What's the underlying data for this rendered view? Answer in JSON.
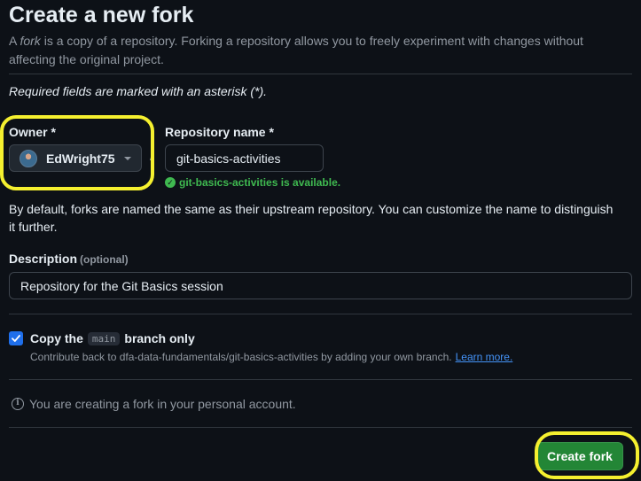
{
  "header": {
    "title": "Create a new fork",
    "subtitle_prefix": "A ",
    "subtitle_em": "fork",
    "subtitle_rest": " is a copy of a repository. Forking a repository allows you to freely experiment with changes without affecting the original project."
  },
  "form": {
    "required_note": "Required fields are marked with an asterisk (*).",
    "owner_label": "Owner *",
    "owner_value": "EdWright75",
    "separator": "/",
    "repo_label": "Repository name *",
    "repo_value": "git-basics-activities",
    "availability_text": "git-basics-activities is available.",
    "default_note": "By default, forks are named the same as their upstream repository. You can customize the name to distinguish it further.",
    "description_label": "Description",
    "description_optional": "(optional)",
    "description_value": "Repository for the Git Basics session",
    "copy_label_prefix": "Copy the",
    "copy_branch": "main",
    "copy_label_suffix": "branch only",
    "copy_checked": true,
    "copy_hint": "Contribute back to dfa-data-fundamentals/git-basics-activities by adding your own branch.",
    "copy_hint_link": "Learn more.",
    "info_text": "You are creating a fork in your personal account.",
    "create_button": "Create fork"
  },
  "colors": {
    "background": "#0d1117",
    "accent_blue": "#1f6feb",
    "success_green": "#3fb950",
    "button_green": "#238636",
    "highlight_yellow": "#f5f02f"
  }
}
